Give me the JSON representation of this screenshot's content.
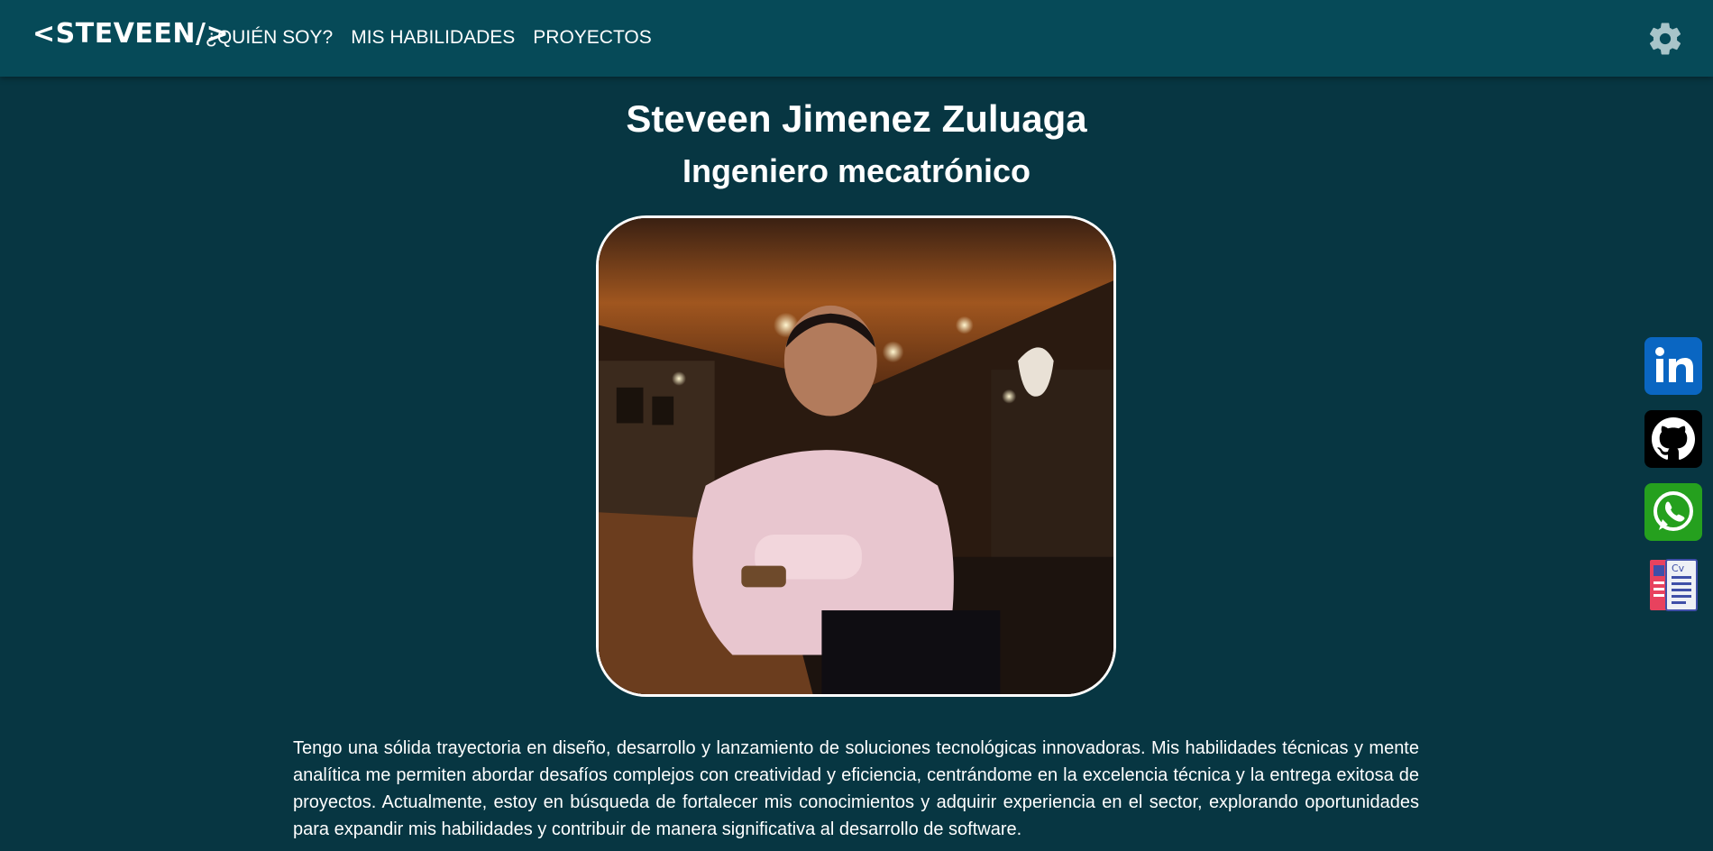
{
  "header": {
    "logo": "<STEVEEN/>",
    "nav": [
      {
        "label": "¿QUIÉN SOY?"
      },
      {
        "label": "MIS HABILIDADES"
      },
      {
        "label": "PROYECTOS"
      }
    ],
    "settings_icon": "gear-icon"
  },
  "hero": {
    "name": "Steveen Jimenez Zuluaga",
    "title": "Ingeniero mecatrónico",
    "photo_icon": "profile-photo"
  },
  "bio": "Tengo una sólida trayectoria en diseño, desarrollo y lanzamiento de soluciones tecnológicas innovadoras. Mis habilidades técnicas y mente analítica me permiten abordar desafíos complejos con creatividad y eficiencia, centrándome en la excelencia técnica y la entrega exitosa de proyectos. Actualmente, estoy en búsqueda de fortalecer mis conocimientos y adquirir experiencia en el sector, explorando oportunidades para expandir mis habilidades y contribuir de manera significativa al desarrollo de software.",
  "social": [
    {
      "icon": "linkedin-icon",
      "color": "#0a66c2"
    },
    {
      "icon": "github-icon",
      "color": "#000000"
    },
    {
      "icon": "whatsapp-icon",
      "color": "#25a01e"
    },
    {
      "icon": "cv-icon",
      "color": "#e8425e"
    }
  ],
  "colors": {
    "background": "#073642",
    "header": "#064a58",
    "text": "#ffffff",
    "gear": "#a8c4c9"
  }
}
